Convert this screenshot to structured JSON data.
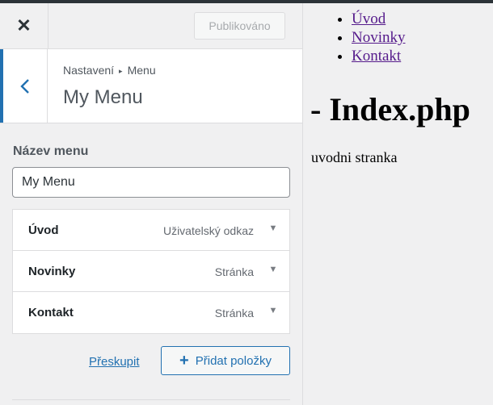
{
  "header": {
    "close_icon": "close-icon",
    "publish_label": "Publikováno"
  },
  "section": {
    "back_icon": "chevron-left-icon",
    "breadcrumb_parent": "Nastavení",
    "breadcrumb_separator": "▸",
    "breadcrumb_current": "Menu",
    "title": "My Menu"
  },
  "menu_name": {
    "label": "Název menu",
    "value": "My Menu"
  },
  "menu_items": [
    {
      "title": "Úvod",
      "type": "Uživatelský odkaz"
    },
    {
      "title": "Novinky",
      "type": "Stránka"
    },
    {
      "title": "Kontakt",
      "type": "Stránka"
    }
  ],
  "actions": {
    "reorder_label": "Přeskupit",
    "add_label": "Přidat položky"
  },
  "preview": {
    "nav": [
      "Úvod",
      "Novinky",
      "Kontakt"
    ],
    "heading": "- Index.php",
    "body": "uvodni stranka"
  },
  "colors": {
    "accent": "#2271b1",
    "link_visited": "#551a8b",
    "panel_bg": "#f0f0f1"
  }
}
